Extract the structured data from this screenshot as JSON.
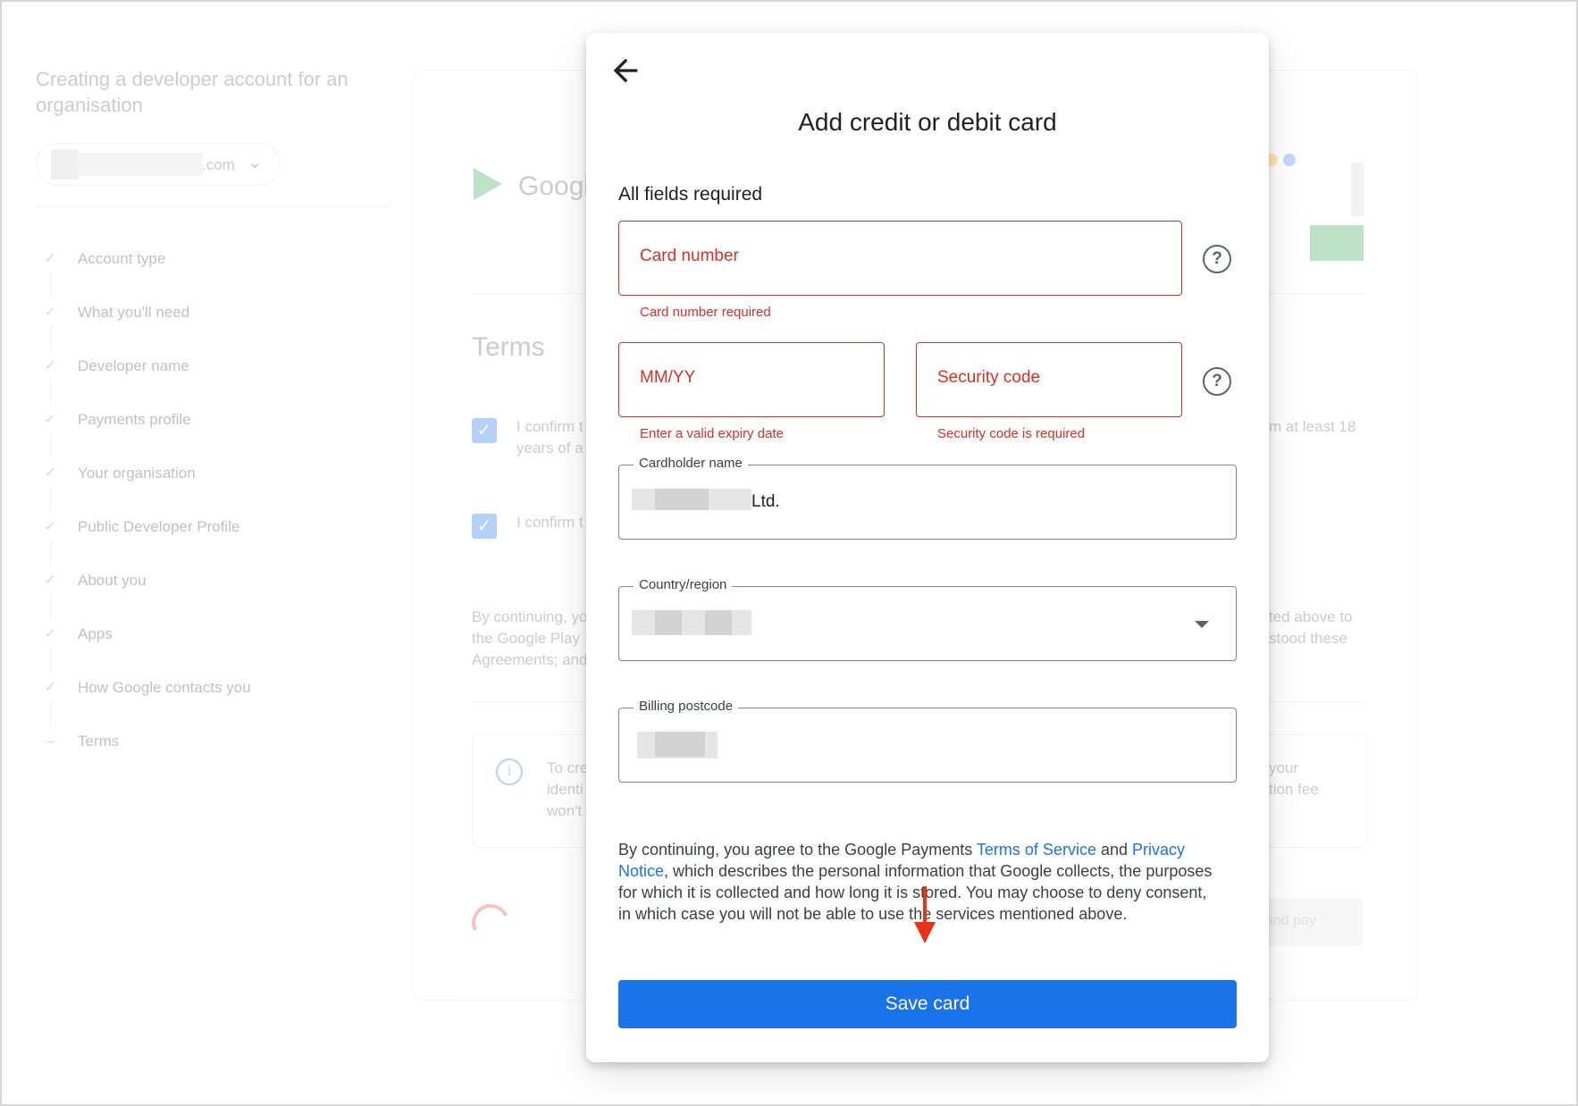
{
  "background": {
    "page_title": "Creating a developer account for an organisation",
    "account_suffix": ".com",
    "steps": [
      {
        "label": "Account type",
        "state": "done"
      },
      {
        "label": "What you'll need",
        "state": "done"
      },
      {
        "label": "Developer name",
        "state": "done"
      },
      {
        "label": "Payments profile",
        "state": "done"
      },
      {
        "label": "Your organisation",
        "state": "done"
      },
      {
        "label": "Public Developer Profile",
        "state": "done"
      },
      {
        "label": "About you",
        "state": "done"
      },
      {
        "label": "Apps",
        "state": "done"
      },
      {
        "label": "How Google contacts you",
        "state": "done"
      },
      {
        "label": "Terms",
        "state": "current"
      }
    ],
    "logo_text": "Googl",
    "section_heading": "Terms",
    "confirm_1_start": "I confirm t",
    "confirm_1_line2": "years of a",
    "confirm_1_end": "m at least 18",
    "confirm_2_start": "I confirm t",
    "continuing_lines": [
      "By continuing, yo",
      "the Google Play",
      "Agreements; and"
    ],
    "continuing_right": [
      "ted above to",
      "stood these"
    ],
    "info_left": [
      "To cre",
      "identi",
      "won't"
    ],
    "info_right": [
      "your",
      "tion fee"
    ],
    "pay_button_fragment": "and pay"
  },
  "modal": {
    "title": "Add credit or debit card",
    "required_note": "All fields required",
    "card_number": {
      "placeholder": "Card number",
      "error": "Card number required"
    },
    "expiry": {
      "placeholder": "MM/YY",
      "error": "Enter a valid expiry date"
    },
    "security_code": {
      "placeholder": "Security code",
      "error": "Security code is required"
    },
    "cardholder": {
      "label": "Cardholder name",
      "value": "Ltd."
    },
    "country": {
      "label": "Country/region"
    },
    "postcode": {
      "label": "Billing postcode"
    },
    "help_glyph": "?",
    "consent": {
      "prefix": "By continuing, you agree to the Google Payments ",
      "tos_link": "Terms of Service",
      "and": " and ",
      "privacy_link": "Privacy Notice",
      "suffix": ", which describes the personal information that Google collects, the purposes for which it is collected and how long it is stored. You may choose to deny consent, in which case you will not be able to use the services mentioned above."
    },
    "save_button": "Save card"
  },
  "colors": {
    "accent": "#1a73e8",
    "error": "#d93025",
    "annotation": "#e8321a"
  },
  "icons": {
    "back": "arrow-left",
    "help": "question-circle",
    "dropdown": "caret-down"
  }
}
